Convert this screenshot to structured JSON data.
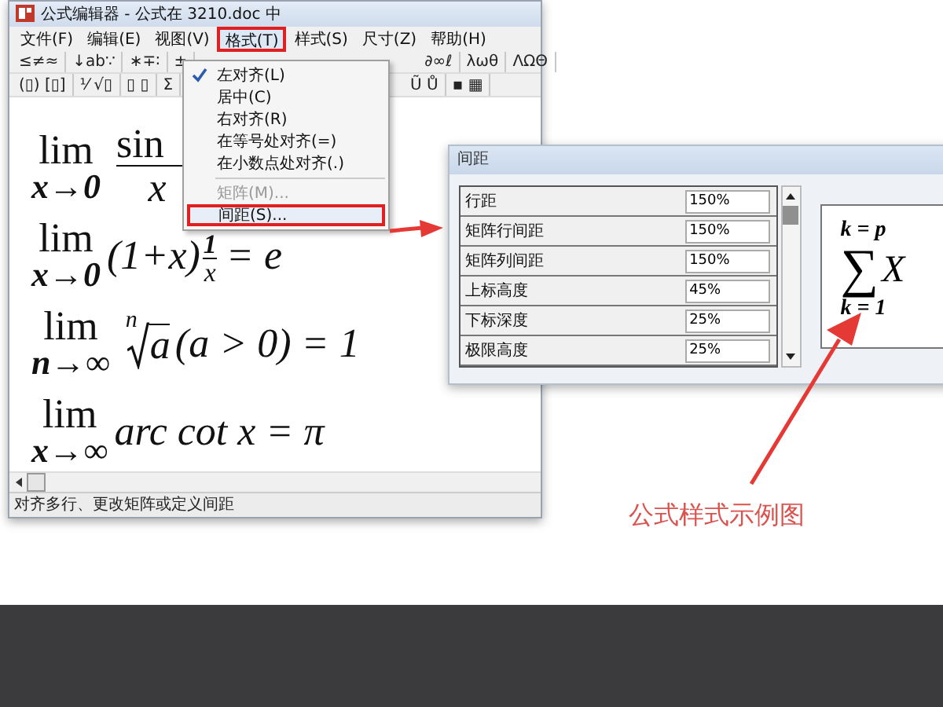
{
  "window": {
    "title": "公式编辑器 - 公式在 3210.doc 中"
  },
  "menu_bar": [
    {
      "label": "文件(F)",
      "selected": false,
      "annotated": false
    },
    {
      "label": "编辑(E)",
      "selected": false,
      "annotated": false
    },
    {
      "label": "视图(V)",
      "selected": false,
      "annotated": false
    },
    {
      "label": "格式(T)",
      "selected": true,
      "annotated": true
    },
    {
      "label": "样式(S)",
      "selected": false,
      "annotated": false
    },
    {
      "label": "尺寸(Z)",
      "selected": false,
      "annotated": false
    },
    {
      "label": "帮助(H)",
      "selected": false,
      "annotated": false
    }
  ],
  "toolbar_rows": [
    [
      "≤≠≈",
      "↓ab∵",
      "∗∓∶",
      "±",
      "∂∞ℓ",
      "λωθ",
      "ΛΩΘ"
    ],
    [
      "(▯) [▯]",
      "⅟ √▯",
      "▯ ▯",
      "Σ",
      "Ũ Ů",
      "▪ ▦"
    ]
  ],
  "format_menu": [
    {
      "label": "左对齐(L)",
      "checked": true,
      "disabled": false,
      "annotated": false
    },
    {
      "label": "居中(C)",
      "checked": false,
      "disabled": false,
      "annotated": false
    },
    {
      "label": "右对齐(R)",
      "checked": false,
      "disabled": false,
      "annotated": false
    },
    {
      "label": "在等号处对齐(=)",
      "checked": false,
      "disabled": false,
      "annotated": false
    },
    {
      "label": "在小数点处对齐(.)",
      "checked": false,
      "disabled": false,
      "annotated": false
    },
    {
      "label": "矩阵(M)...",
      "checked": false,
      "disabled": true,
      "annotated": false
    },
    {
      "label": "间距(S)...",
      "checked": false,
      "disabled": false,
      "annotated": true
    }
  ],
  "formulas": [
    {
      "kind": "fraction",
      "lim": "lim",
      "under": "x→0",
      "numerator": "sin",
      "denominator": "x"
    },
    {
      "kind": "power",
      "lim": "lim",
      "under": "x→0",
      "base": "(1+x)",
      "exp_numerator": "1",
      "exp_denominator": "x",
      "rest": "= e"
    },
    {
      "kind": "root",
      "lim": "lim",
      "under": "n→∞",
      "index": "n",
      "radicand": "a",
      "rest": "(a > 0) = 1"
    },
    {
      "kind": "plain",
      "lim": "lim",
      "under": "x→∞",
      "body": "arc cot x = π"
    }
  ],
  "status_bar": "对齐多行、更改矩阵或定义间距",
  "spacing_dialog": {
    "title": "间距",
    "rows": [
      {
        "label": "行距",
        "value": "150%"
      },
      {
        "label": "矩阵行间距",
        "value": "150%"
      },
      {
        "label": "矩阵列间距",
        "value": "150%"
      },
      {
        "label": "上标高度",
        "value": "45%"
      },
      {
        "label": "下标深度",
        "value": "25%"
      },
      {
        "label": "极限高度",
        "value": "25%"
      }
    ],
    "preview": {
      "upper": "k = p",
      "operator": "∑",
      "term": "X",
      "lower": "k = 1"
    }
  },
  "caption": "公式样式示例图"
}
